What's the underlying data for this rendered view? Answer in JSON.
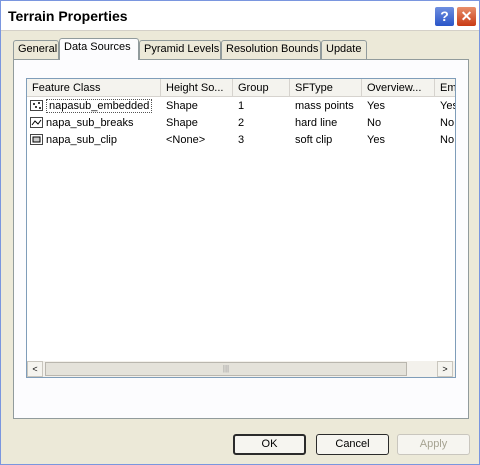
{
  "window": {
    "title": "Terrain Properties"
  },
  "titlebar_buttons": {
    "help": "?",
    "close": "✕"
  },
  "tabs": [
    {
      "label": "General"
    },
    {
      "label": "Data Sources"
    },
    {
      "label": "Pyramid Levels"
    },
    {
      "label": "Resolution Bounds"
    },
    {
      "label": "Update"
    }
  ],
  "active_tab": "Data Sources",
  "table": {
    "columns": [
      "Feature Class",
      "Height So...",
      "Group",
      "SFType",
      "Overview...",
      "Em"
    ],
    "rows": [
      {
        "icon": "point-feature-class-icon",
        "cells": [
          "napasub_embedded",
          "Shape",
          "1",
          "mass points",
          "Yes",
          "Yes"
        ]
      },
      {
        "icon": "line-feature-class-icon",
        "cells": [
          "napa_sub_breaks",
          "Shape",
          "2",
          "hard line",
          "No",
          "No"
        ]
      },
      {
        "icon": "polygon-feature-class-icon",
        "cells": [
          "napa_sub_clip",
          "<None>",
          "3",
          "soft clip",
          "Yes",
          "No"
        ]
      }
    ]
  },
  "scrollbar": {
    "left_arrow": "<",
    "right_arrow": ">",
    "thumb_grip": "|||"
  },
  "buttons": {
    "ok": "OK",
    "cancel": "Cancel",
    "apply": "Apply"
  }
}
